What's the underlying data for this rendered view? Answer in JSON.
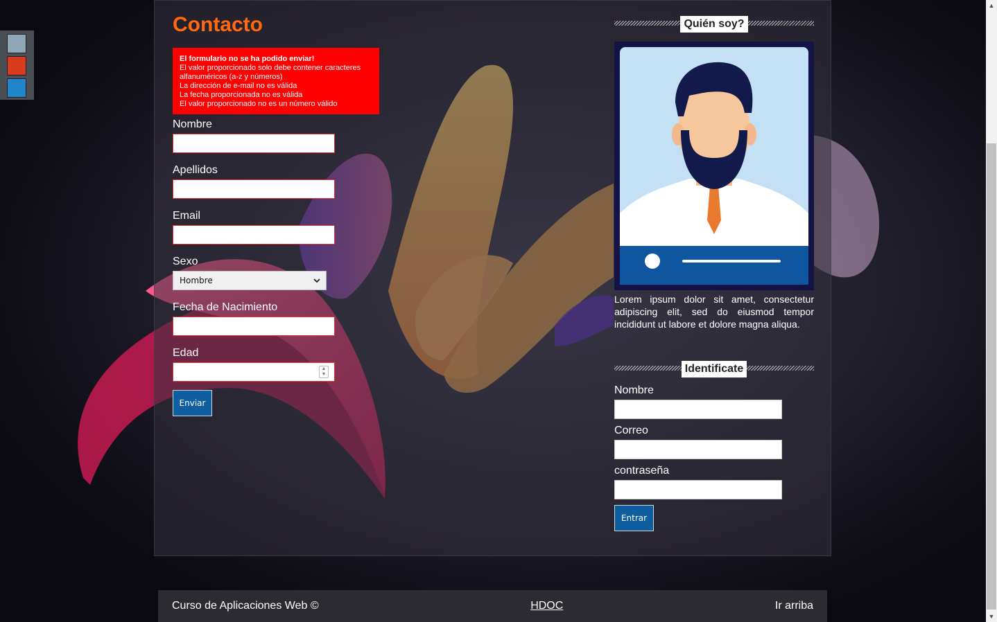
{
  "colors": {
    "accent": "#ff6a10",
    "error_bg": "#ff0000",
    "button_bg": "#0e5ea0",
    "swatches": [
      "#8fa7b6",
      "#d53b1c",
      "#2185cb"
    ]
  },
  "theme_switcher": {
    "swatches": [
      "blue-grey",
      "orange-red",
      "blue"
    ]
  },
  "contact": {
    "title": "Contacto",
    "errors": {
      "title": "El formulario no se ha podido enviar!",
      "items": [
        "El valor proporcionado solo debe contener caracteres alfanuméricos (a-z y números)",
        "La dirección de e-mail no es válida",
        "La fecha proporcionada no es válida",
        "El valor proporcionado no es un número válido"
      ]
    },
    "fields": {
      "nombre_label": "Nombre",
      "apellidos_label": "Apellidos",
      "email_label": "Email",
      "sexo_label": "Sexo",
      "sexo_value": "Hombre",
      "fecha_label": "Fecha de Nacimiento",
      "edad_label": "Edad"
    },
    "submit_label": "Enviar"
  },
  "about": {
    "heading": "Quién soy?",
    "text": "Lorem ipsum dolor sit amet, consectetur adipiscing elit, sed do eiusmod tempor incididunt ut labore et dolore magna aliqua."
  },
  "login": {
    "heading": "Identificate",
    "nombre_label": "Nombre",
    "correo_label": "Correo",
    "password_label": "contraseña",
    "submit_label": "Entrar"
  },
  "footer": {
    "copyright": "Curso de Aplicaciones Web ©",
    "link": "HDOC",
    "top_link": "Ir arriba"
  }
}
